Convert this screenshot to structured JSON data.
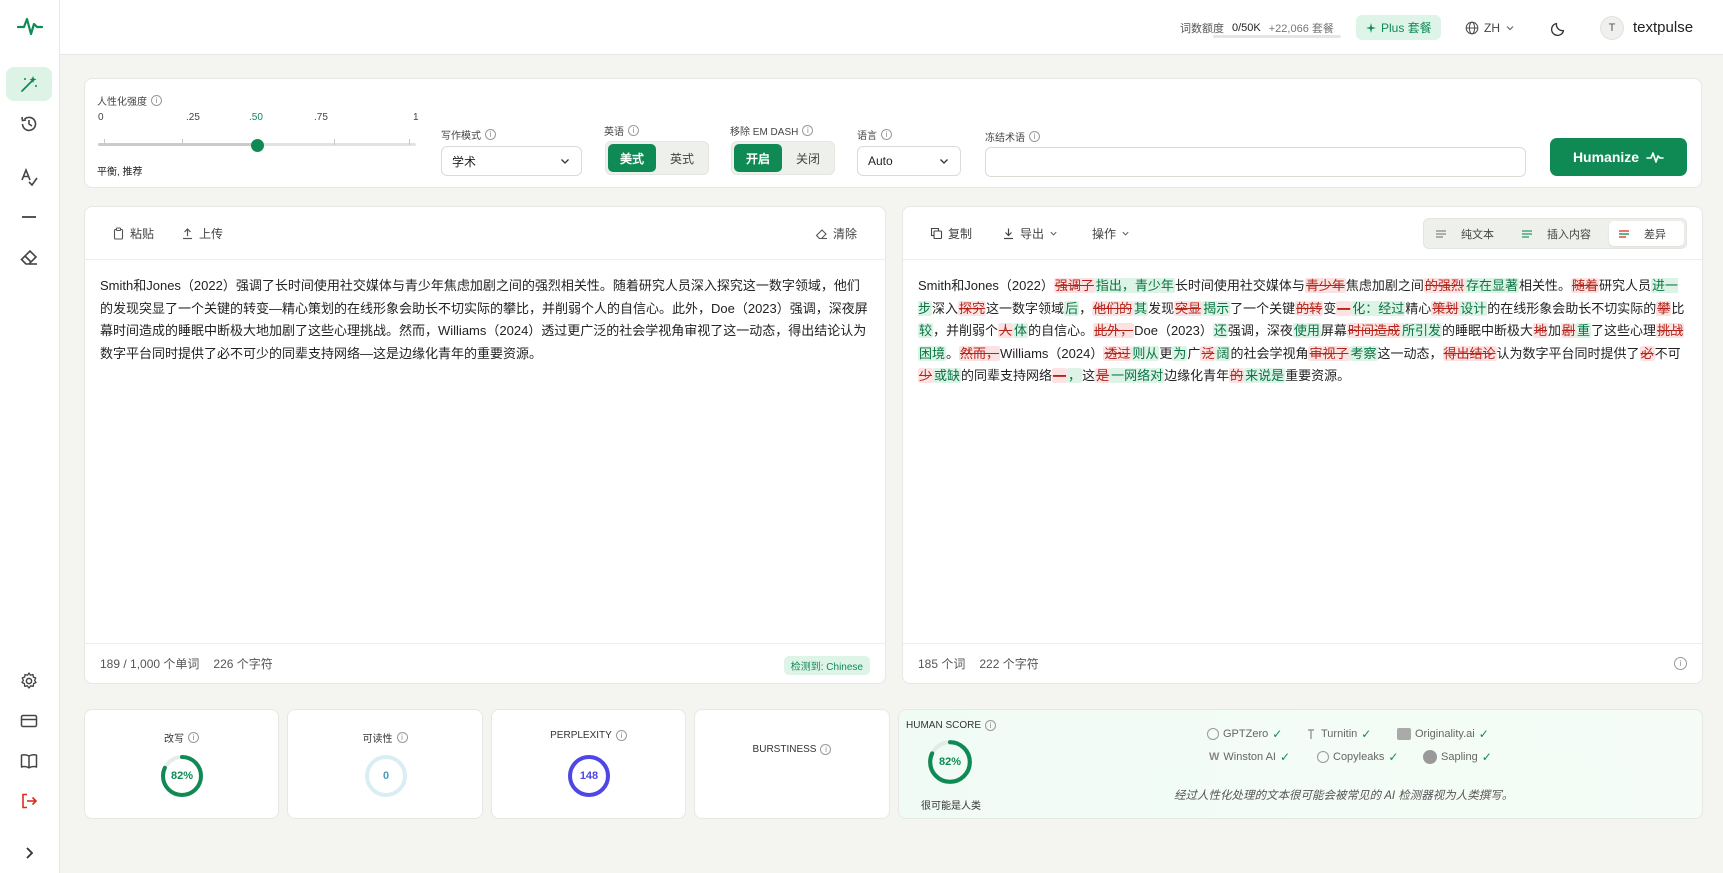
{
  "header": {
    "quota_label": "词数额度",
    "quota_value": "0/50K",
    "quota_extra": "+22,066 套餐",
    "quota_used_fraction": 0,
    "plan_badge": "Plus 套餐",
    "language": "ZH",
    "user_initial": "T",
    "username": "textpulse"
  },
  "controls": {
    "strength_label": "人性化强度",
    "strength_ticks": [
      "0",
      ".25",
      ".50",
      ".75",
      "1"
    ],
    "strength_value": 0.5,
    "strength_desc": "平衡, 推荐",
    "writing_mode_label": "写作模式",
    "writing_mode_value": "学术",
    "english_label": "英语",
    "english_options": [
      "美式",
      "英式"
    ],
    "english_selected": "美式",
    "em_dash_label": "移除 EM DASH",
    "em_dash_options": [
      "开启",
      "关闭"
    ],
    "em_dash_selected": "开启",
    "language_label": "语言",
    "language_value": "Auto",
    "freeze_label": "冻结术语",
    "freeze_value": "",
    "humanize_label": "Humanize"
  },
  "input_panel": {
    "paste": "粘贴",
    "upload": "上传",
    "clear": "清除",
    "text": "Smith和Jones（2022）强调了长时间使用社交媒体与青少年焦虑加剧之间的强烈相关性。随着研究人员深入探究这一数字领域，他们的发现突显了一个关键的转变—精心策划的在线形象会助长不切实际的攀比，并削弱个人的自信心。此外，Doe（2023）强调，深夜屏幕时间造成的睡眠中断极大地加剧了这些心理挑战。然而，Williams（2024）透过更广泛的社会学视角审视了这一动态，得出结论认为数字平台同时提供了必不可少的同辈支持网络—这是边缘化青年的重要资源。",
    "word_count": "189 / 1,000 个单词",
    "char_count": "226 个字符",
    "detected": "检测到: Chinese"
  },
  "output_panel": {
    "copy": "复制",
    "export": "导出",
    "actions": "操作",
    "view_plain": "纯文本",
    "view_insert": "插入内容",
    "view_diff": "差异",
    "segments": [
      {
        "t": "n",
        "s": "Smith和Jones（2022）"
      },
      {
        "t": "d",
        "s": "强调了"
      },
      {
        "t": "i",
        "s": "指出，青少年"
      },
      {
        "t": "n",
        "s": "长时间使用社交媒体与"
      },
      {
        "t": "d",
        "s": "青少年"
      },
      {
        "t": "n",
        "s": "焦虑加剧之间"
      },
      {
        "t": "d",
        "s": "的强烈"
      },
      {
        "t": "i",
        "s": "存在显著"
      },
      {
        "t": "n",
        "s": "相关性。"
      },
      {
        "t": "d",
        "s": "随着"
      },
      {
        "t": "n",
        "s": "研究人员"
      },
      {
        "t": "i",
        "s": "进一步"
      },
      {
        "t": "n",
        "s": "深入"
      },
      {
        "t": "d",
        "s": "探究"
      },
      {
        "t": "n",
        "s": "这一数字领域"
      },
      {
        "t": "i",
        "s": "后"
      },
      {
        "t": "n",
        "s": "，"
      },
      {
        "t": "d",
        "s": "他们的"
      },
      {
        "t": "i",
        "s": "其"
      },
      {
        "t": "n",
        "s": "发现"
      },
      {
        "t": "d",
        "s": "突显"
      },
      {
        "t": "i",
        "s": "揭示"
      },
      {
        "t": "n",
        "s": "了一个关键"
      },
      {
        "t": "d",
        "s": "的转"
      },
      {
        "t": "n",
        "s": "变"
      },
      {
        "t": "d",
        "s": "—"
      },
      {
        "t": "i",
        "s": "化：经过"
      },
      {
        "t": "n",
        "s": "精心"
      },
      {
        "t": "d",
        "s": "策划"
      },
      {
        "t": "i",
        "s": "设计"
      },
      {
        "t": "n",
        "s": "的在线形象会助长不切实际的"
      },
      {
        "t": "d",
        "s": "攀"
      },
      {
        "t": "n",
        "s": "比"
      },
      {
        "t": "i",
        "s": "较"
      },
      {
        "t": "n",
        "s": "，并削弱个"
      },
      {
        "t": "d",
        "s": "人"
      },
      {
        "t": "i",
        "s": "体"
      },
      {
        "t": "n",
        "s": "的自信心。"
      },
      {
        "t": "d",
        "s": "此外，"
      },
      {
        "t": "n",
        "s": "Doe（2023）"
      },
      {
        "t": "i",
        "s": "还"
      },
      {
        "t": "n",
        "s": "强调，深夜"
      },
      {
        "t": "i",
        "s": "使用"
      },
      {
        "t": "n",
        "s": "屏幕"
      },
      {
        "t": "d",
        "s": "时间造成"
      },
      {
        "t": "i",
        "s": "所引发"
      },
      {
        "t": "n",
        "s": "的睡眠中断极大"
      },
      {
        "t": "d",
        "s": "地"
      },
      {
        "t": "n",
        "s": "加"
      },
      {
        "t": "d",
        "s": "剧"
      },
      {
        "t": "i",
        "s": "重"
      },
      {
        "t": "n",
        "s": "了这些心理"
      },
      {
        "t": "d",
        "s": "挑战"
      },
      {
        "t": "i",
        "s": "困境"
      },
      {
        "t": "n",
        "s": "。"
      },
      {
        "t": "d",
        "s": "然而，"
      },
      {
        "t": "n",
        "s": "Williams（2024）"
      },
      {
        "t": "d",
        "s": "透过"
      },
      {
        "t": "i",
        "s": "则从"
      },
      {
        "t": "n",
        "s": "更"
      },
      {
        "t": "i",
        "s": "为"
      },
      {
        "t": "n",
        "s": "广"
      },
      {
        "t": "d",
        "s": "泛"
      },
      {
        "t": "i",
        "s": "阔"
      },
      {
        "t": "n",
        "s": "的社会学视角"
      },
      {
        "t": "d",
        "s": "审视了"
      },
      {
        "t": "i",
        "s": "考察"
      },
      {
        "t": "n",
        "s": "这一动态，"
      },
      {
        "t": "d",
        "s": "得出结论"
      },
      {
        "t": "n",
        "s": "认为数字平台同时提供了"
      },
      {
        "t": "d",
        "s": "必"
      },
      {
        "t": "n",
        "s": "不可"
      },
      {
        "t": "d",
        "s": "少"
      },
      {
        "t": "i",
        "s": "或缺"
      },
      {
        "t": "n",
        "s": "的同辈支持网络"
      },
      {
        "t": "d",
        "s": "—"
      },
      {
        "t": "i",
        "s": "，"
      },
      {
        "t": "n",
        "s": "这"
      },
      {
        "t": "d",
        "s": "是"
      },
      {
        "t": "i",
        "s": "一网络对"
      },
      {
        "t": "n",
        "s": "边缘化青年"
      },
      {
        "t": "d",
        "s": "的"
      },
      {
        "t": "i",
        "s": "来说是"
      },
      {
        "t": "n",
        "s": "重要资源。"
      }
    ],
    "word_count": "185 个词",
    "char_count": "222 个字符"
  },
  "metrics": {
    "rewrite_label": "改写",
    "rewrite_value": "82%",
    "rewrite_fraction": 0.82,
    "readability_label": "可读性",
    "readability_value": "0",
    "readability_fraction": 0,
    "perplexity_label": "PERPLEXITY",
    "perplexity_value": "148",
    "perplexity_fraction": 1,
    "burstiness_label": "BURSTINESS",
    "human_label": "HUMAN SCORE",
    "human_value": "82%",
    "human_fraction": 0.82,
    "human_desc": "很可能是人类",
    "detectors": [
      "GPTZero",
      "Turnitin",
      "Originality.ai",
      "Winston AI",
      "Copyleaks",
      "Sapling"
    ],
    "note": "经过人性化处理的文本很可能会被常见的 AI 检测器视为人类撰写。"
  },
  "colors": {
    "accent": "#0f8a55",
    "perplexity": "#4f46e5",
    "readability": "#9fd3e3",
    "delete_bg": "#fbe3e3",
    "insert_bg": "#dcf3e6"
  }
}
